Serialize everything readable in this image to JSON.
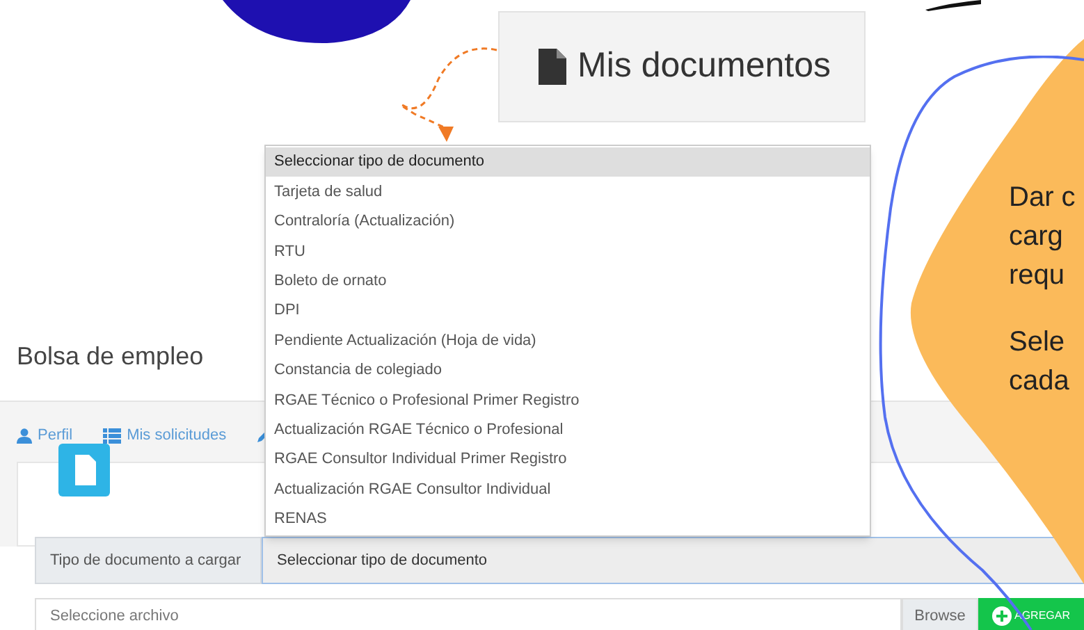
{
  "callout": {
    "title": "Mis documentos"
  },
  "page": {
    "title": "Bolsa de empleo"
  },
  "tabs": [
    {
      "label": "Perfil",
      "kind": "user"
    },
    {
      "label": "Mis solicitudes",
      "kind": "list"
    },
    {
      "kind": "pencil"
    }
  ],
  "form": {
    "type_label": "Tipo de documento a cargar",
    "type_value": "Seleccionar tipo de documento",
    "file_placeholder": "Seleccione archivo",
    "browse": "Browse",
    "add": "AGREGAR"
  },
  "dropdown": {
    "options": [
      {
        "label": "Seleccionar tipo de documento",
        "selected": true
      },
      {
        "label": "Tarjeta de salud",
        "selected": false
      },
      {
        "label": "Contraloría (Actualización)",
        "selected": false
      },
      {
        "label": "RTU",
        "selected": false
      },
      {
        "label": "Boleto de ornato",
        "selected": false
      },
      {
        "label": "DPI",
        "selected": false
      },
      {
        "label": "Pendiente Actualización (Hoja de vida)",
        "selected": false
      },
      {
        "label": "Constancia de colegiado",
        "selected": false
      },
      {
        "label": "RGAE Técnico o Profesional Primer Registro",
        "selected": false
      },
      {
        "label": "Actualización RGAE Técnico o Profesional",
        "selected": false
      },
      {
        "label": "RGAE Consultor Individual Primer Registro",
        "selected": false
      },
      {
        "label": "Actualización RGAE Consultor Individual",
        "selected": false
      },
      {
        "label": "RENAS",
        "selected": false
      }
    ]
  },
  "note": {
    "paragraphs": [
      [
        "Dar c",
        "carg",
        "requ"
      ],
      [
        "Sele",
        "cada"
      ]
    ]
  }
}
